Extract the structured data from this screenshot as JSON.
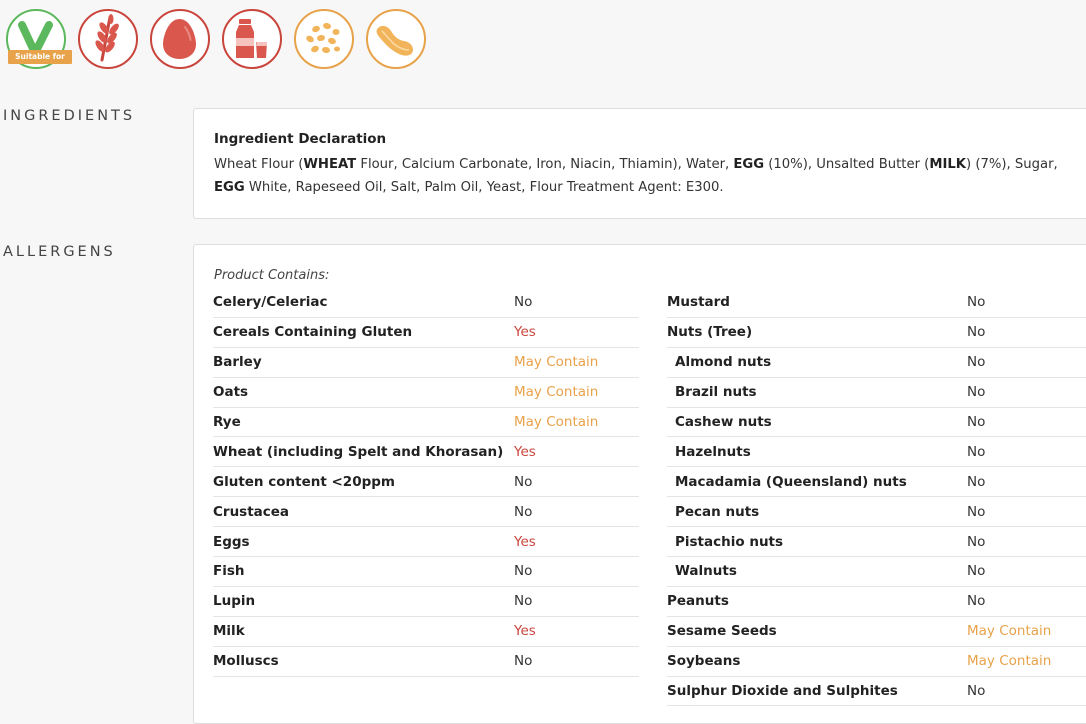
{
  "badges": [
    {
      "name": "vegetarian-icon",
      "label": "Suitable for",
      "color": "#5cb85c"
    },
    {
      "name": "wheat-icon",
      "color": "#c9463d"
    },
    {
      "name": "egg-icon",
      "color": "#c9463d"
    },
    {
      "name": "milk-icon",
      "color": "#c9463d"
    },
    {
      "name": "oats-icon",
      "color": "#e8a24a"
    },
    {
      "name": "soybean-icon",
      "color": "#e8a24a"
    }
  ],
  "sections": {
    "ingredients": "INGREDIENTS",
    "allergens": "ALLERGENS"
  },
  "ingredients": {
    "title": "Ingredient Declaration",
    "parts": [
      {
        "t": "Wheat Flour (",
        "b": false
      },
      {
        "t": "WHEAT",
        "b": true
      },
      {
        "t": " Flour, Calcium Carbonate, Iron, Niacin, Thiamin), Water, ",
        "b": false
      },
      {
        "t": "EGG",
        "b": true
      },
      {
        "t": " (10%), Unsalted Butter (",
        "b": false
      },
      {
        "t": "MILK",
        "b": true
      },
      {
        "t": ") (7%), Sugar, ",
        "b": false
      },
      {
        "t": "EGG",
        "b": true
      },
      {
        "t": " White, Rapeseed Oil, Salt, Palm Oil, Yeast, Flour Treatment Agent: E300.",
        "b": false
      }
    ]
  },
  "allergens": {
    "intro": "Product Contains:",
    "left": [
      {
        "name": "Celery/Celeriac",
        "value": "No"
      },
      {
        "name": "Cereals Containing Gluten",
        "value": "Yes"
      },
      {
        "name": "Barley",
        "value": "May Contain"
      },
      {
        "name": "Oats",
        "value": "May Contain"
      },
      {
        "name": "Rye",
        "value": "May Contain"
      },
      {
        "name": "Wheat (including Spelt and Khorasan)",
        "value": "Yes"
      },
      {
        "name": "Gluten content <20ppm",
        "value": "No"
      },
      {
        "name": "Crustacea",
        "value": "No"
      },
      {
        "name": "Eggs",
        "value": "Yes"
      },
      {
        "name": "Fish",
        "value": "No"
      },
      {
        "name": "Lupin",
        "value": "No"
      },
      {
        "name": "Milk",
        "value": "Yes"
      },
      {
        "name": "Molluscs",
        "value": "No"
      }
    ],
    "right": [
      {
        "name": "Mustard",
        "value": "No"
      },
      {
        "name": "Nuts (Tree)",
        "value": "No"
      },
      {
        "name": "Almond nuts",
        "value": "No",
        "sub": true
      },
      {
        "name": "Brazil nuts",
        "value": "No",
        "sub": true
      },
      {
        "name": "Cashew nuts",
        "value": "No",
        "sub": true
      },
      {
        "name": "Hazelnuts",
        "value": "No",
        "sub": true
      },
      {
        "name": "Macadamia (Queensland) nuts",
        "value": "No",
        "sub": true
      },
      {
        "name": "Pecan nuts",
        "value": "No",
        "sub": true
      },
      {
        "name": "Pistachio nuts",
        "value": "No",
        "sub": true
      },
      {
        "name": "Walnuts",
        "value": "No",
        "sub": true
      },
      {
        "name": "Peanuts",
        "value": "No"
      },
      {
        "name": "Sesame Seeds",
        "value": "May Contain"
      },
      {
        "name": "Soybeans",
        "value": "May Contain"
      },
      {
        "name": "Sulphur Dioxide and Sulphites",
        "value": "No"
      }
    ]
  }
}
